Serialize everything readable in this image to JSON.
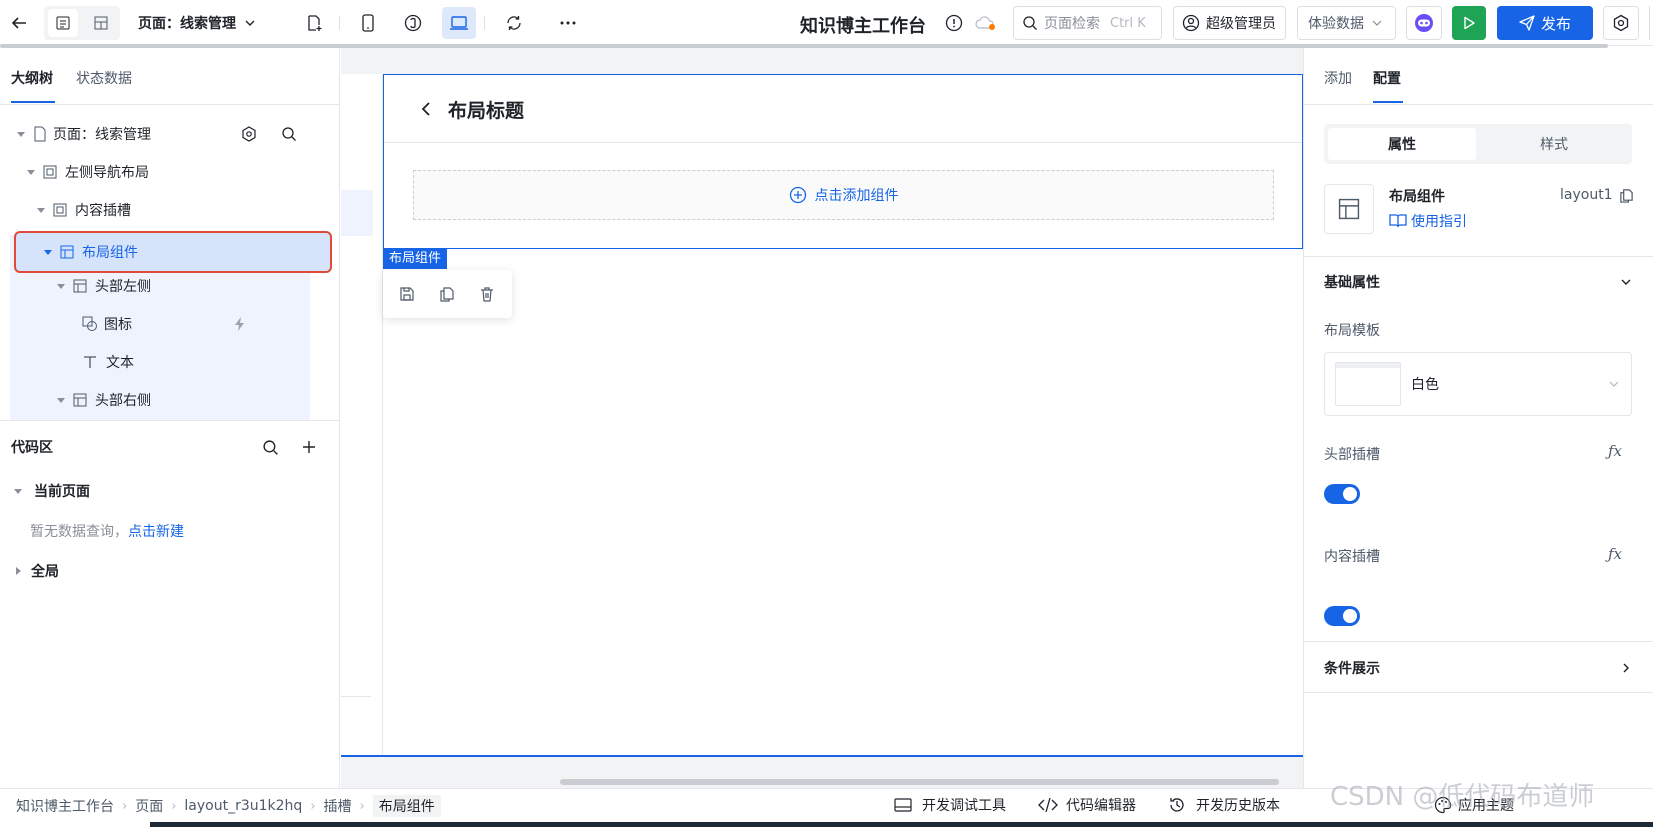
{
  "header": {
    "page_selector": "页面：线索管理",
    "app_title": "知识博主工作台",
    "search_placeholder": "页面检索",
    "search_shortcut": "Ctrl K",
    "user_role": "超级管理员",
    "data_mode": "体验数据",
    "publish_label": "发布"
  },
  "left_panel": {
    "tabs": [
      "大纲树",
      "状态数据"
    ],
    "tree": [
      "页面：线索管理",
      "左侧导航布局",
      "内容插槽",
      "布局组件",
      "头部左侧",
      "图标",
      "文本",
      "头部右侧"
    ],
    "code_area": {
      "title": "代码区",
      "current_page": "当前页面",
      "empty_text": "暂无数据查询，",
      "create_link": "点击新建",
      "global": "全局"
    }
  },
  "canvas": {
    "layout_title": "布局标题",
    "add_component": "点击添加组件",
    "selected_label": "布局组件"
  },
  "right_panel": {
    "tabs": [
      "添加",
      "配置"
    ],
    "segments": [
      "属性",
      "样式"
    ],
    "component_name": "布局组件",
    "component_id": "layout1",
    "guide_link": "使用指引",
    "section_basic": "基础属性",
    "layout_template_label": "布局模板",
    "layout_template_value": "白色",
    "header_slot_label": "头部插槽",
    "header_slot_on": true,
    "content_slot_label": "内容插槽",
    "content_slot_on": true,
    "section_condition": "条件展示"
  },
  "breadcrumb": [
    "知识博主工作台",
    "页面",
    "layout_r3u1k2hq",
    "插槽",
    "布局组件"
  ],
  "footer_tools": [
    "开发调试工具",
    "代码编辑器",
    "开发历史版本",
    "应用主题"
  ],
  "watermark": "CSDN @低代码布道师",
  "colors": {
    "accent": "#1764e6",
    "publish": "#1764e6",
    "run": "#1fa355",
    "highlight": "#d6e4fb",
    "selection_border": "#e04a3a"
  }
}
